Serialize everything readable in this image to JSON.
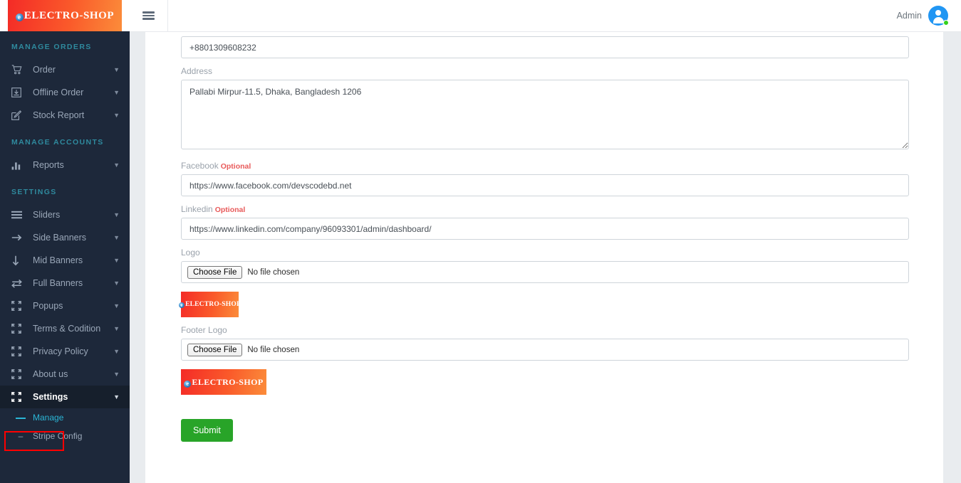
{
  "brand": {
    "name": "ELECTRO-SHOP",
    "logo_gradient_from": "#f42b27",
    "logo_gradient_to": "#fb8c3a"
  },
  "topbar": {
    "menu_toggle": "hamburger-menu",
    "user_name": "Admin",
    "status": "online"
  },
  "sidebar": {
    "sections": [
      {
        "title": "MANAGE ORDERS"
      },
      {
        "title": "MANAGE ACCOUNTS"
      },
      {
        "title": "SETTINGS"
      }
    ],
    "manage_orders": [
      {
        "label": "Order",
        "icon": "shopping-cart-icon",
        "chevron": "⌄"
      },
      {
        "label": "Offline Order",
        "icon": "inbox-download-icon",
        "chevron": "⌄"
      },
      {
        "label": "Stock Report",
        "icon": "edit-square-icon",
        "chevron": "⌄"
      }
    ],
    "manage_accounts": [
      {
        "label": "Reports",
        "icon": "bar-chart-icon",
        "chevron": "⌄"
      }
    ],
    "settings": [
      {
        "label": "Sliders",
        "icon": "bars-icon",
        "chevron": "⌄"
      },
      {
        "label": "Side Banners",
        "icon": "arrow-right-icon",
        "chevron": "⌄"
      },
      {
        "label": "Mid Banners",
        "icon": "arrow-down-icon",
        "chevron": "⌄"
      },
      {
        "label": "Full Banners",
        "icon": "exchange-arrows-icon",
        "chevron": "⌄"
      },
      {
        "label": "Popups",
        "icon": "arrows-alt-icon",
        "chevron": "⌄"
      },
      {
        "label": "Terms & Codition",
        "icon": "arrows-alt-icon",
        "chevron": "⌄"
      },
      {
        "label": "Privacy Policy",
        "icon": "arrows-alt-icon",
        "chevron": "⌄"
      },
      {
        "label": "About us",
        "icon": "arrows-alt-icon",
        "chevron": "⌄"
      },
      {
        "label": "Settings",
        "icon": "arrows-alt-icon",
        "chevron": "⌄"
      }
    ],
    "settings_sub": [
      {
        "label": "Manage",
        "current": true
      },
      {
        "label": "Stripe Config",
        "current": false
      }
    ],
    "accent_color": "#2bb6d6",
    "section_color": "#2f8a9e",
    "background": "#1d283a",
    "annotation_color": "#ff0000"
  },
  "form": {
    "phone": {
      "value": "+8801309608232"
    },
    "address": {
      "label": "Address",
      "value": "Pallabi Mirpur-11.5, Dhaka, Bangladesh 1206"
    },
    "facebook": {
      "label": "Facebook",
      "optional": "Optional",
      "value": "https://www.facebook.com/devscodebd.net"
    },
    "linkedin": {
      "label": "Linkedin",
      "optional": "Optional",
      "value": "https://www.linkedin.com/company/96093301/admin/dashboard/"
    },
    "logo": {
      "label": "Logo",
      "choose_file": "Choose File",
      "no_file": "No file chosen",
      "preview_text": "ELECTRO-SHOP"
    },
    "footer_logo": {
      "label": "Footer Logo",
      "choose_file": "Choose File",
      "no_file": "No file chosen",
      "preview_text": "ELECTRO-SHOP"
    },
    "submit_label": "Submit",
    "submit_color": "#28a428"
  }
}
